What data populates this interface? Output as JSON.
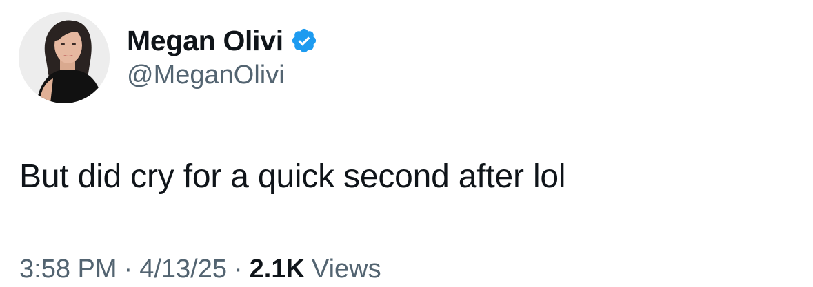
{
  "author": {
    "display_name": "Megan Olivi",
    "handle": "@MeganOlivi",
    "verified": true,
    "verified_badge_color": "#1d9bf0",
    "avatar": "profile-photo"
  },
  "tweet": {
    "text": "But did cry for a quick second after lol"
  },
  "meta": {
    "time": "3:58 PM",
    "separator": "·",
    "date": "4/13/25",
    "views_count": "2.1K",
    "views_label": "Views"
  },
  "colors": {
    "text_primary": "#0f1419",
    "text_secondary": "#536471",
    "background": "#ffffff"
  }
}
